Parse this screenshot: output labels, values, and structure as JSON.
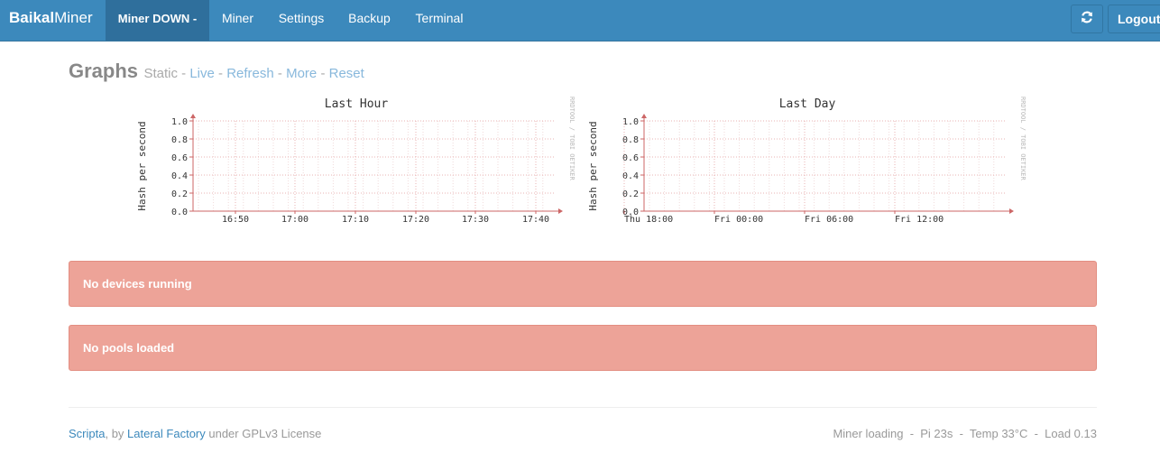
{
  "navbar": {
    "brand_bold": "Baikal",
    "brand_rest": "Miner",
    "items": [
      {
        "label": "Miner DOWN -",
        "active": true
      },
      {
        "label": "Miner",
        "active": false
      },
      {
        "label": "Settings",
        "active": false
      },
      {
        "label": "Backup",
        "active": false
      },
      {
        "label": "Terminal",
        "active": false
      }
    ],
    "refresh_icon": "refresh-icon",
    "logout_label": "Logout"
  },
  "graphs": {
    "title": "Graphs",
    "mode_static": "Static",
    "links": [
      "Live",
      "Refresh",
      "More",
      "Reset"
    ],
    "separator": "-"
  },
  "chart_data": [
    {
      "type": "line",
      "title": "Last Hour",
      "ylabel": "Hash per second",
      "watermark": "RRDTOOL / TOBI OETIKER",
      "yticks": [
        "1.0",
        "0.8",
        "0.6",
        "0.4",
        "0.2",
        "0.0"
      ],
      "ylim": [
        0,
        1.0
      ],
      "xticks": [
        "16:50",
        "17:00",
        "17:10",
        "17:20",
        "17:30",
        "17:40"
      ],
      "series": [],
      "grid": true
    },
    {
      "type": "line",
      "title": "Last Day",
      "ylabel": "Hash per second",
      "watermark": "RRDTOOL / TOBI OETIKER",
      "yticks": [
        "1.0",
        "0.8",
        "0.6",
        "0.4",
        "0.2",
        "0.0"
      ],
      "ylim": [
        0,
        1.0
      ],
      "xticks": [
        "Thu 18:00",
        "Fri 00:00",
        "Fri 06:00",
        "Fri 12:00"
      ],
      "series": [],
      "grid": true
    }
  ],
  "alerts": {
    "devices": "No devices running",
    "pools": "No pools loaded"
  },
  "footer": {
    "scripta": "Scripta",
    "by": ", by ",
    "lateral": "Lateral Factory",
    "license": " under GPLv3 License",
    "status": "Miner loading  -  Pi 23s  -  Temp 33°C  -  Load 0.13"
  },
  "colors": {
    "navbar": "#3c89bc",
    "navbar_active": "#2f6f9c",
    "alert_bg": "#eda398",
    "link": "#3c89bc",
    "graph_link": "#88b8dc"
  }
}
